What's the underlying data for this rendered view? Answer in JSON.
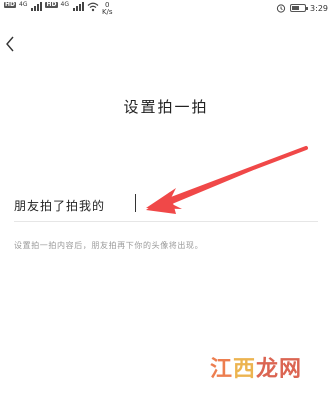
{
  "status_bar": {
    "sim1": "HD",
    "sim2": "HD",
    "net1": "4G",
    "net2": "4G",
    "speed_value": "0",
    "speed_unit": "K/s",
    "time": "3:29",
    "battery_level": 0.55
  },
  "header": {
    "back_glyph": "<",
    "title": "设置拍一拍"
  },
  "form": {
    "prefix_label": "朋友拍了拍我的",
    "input_value": "",
    "hint": "设置拍一拍内容后，朋友拍再下你的头像将出现。"
  },
  "watermark": {
    "part1": "江",
    "part2": "西",
    "part3": "龙网"
  },
  "colors": {
    "arrow": "#f04848",
    "hint": "#9a9a9a",
    "divider": "#e6e6e6"
  },
  "icons": [
    "back-icon",
    "alarm-icon",
    "battery-icon",
    "signal-icon",
    "wifi-icon"
  ]
}
